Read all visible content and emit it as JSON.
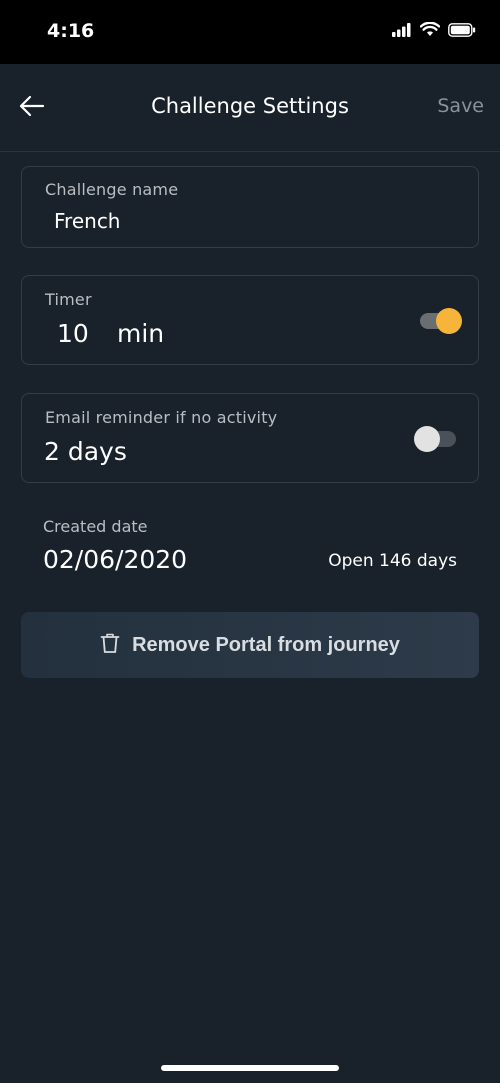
{
  "status_bar": {
    "time": "4:16",
    "icons": [
      "signal-icon",
      "wifi-icon",
      "battery-icon"
    ]
  },
  "nav": {
    "title": "Challenge Settings",
    "save_label": "Save",
    "back_icon": "back-arrow-icon"
  },
  "challenge_name": {
    "label": "Challenge name",
    "value": "French"
  },
  "timer": {
    "label": "Timer",
    "value": "10",
    "unit": "min",
    "enabled": true
  },
  "email_reminder": {
    "label": "Email reminder if no activity",
    "value": "2 days",
    "enabled": false
  },
  "created": {
    "label": "Created date",
    "date": "02/06/2020",
    "open_days": "Open 146 days"
  },
  "remove_button": {
    "label": "Remove Portal from journey",
    "icon": "trash-icon"
  },
  "colors": {
    "background": "#19222a",
    "accent": "#f6b43a",
    "card_border": "#333d46"
  }
}
